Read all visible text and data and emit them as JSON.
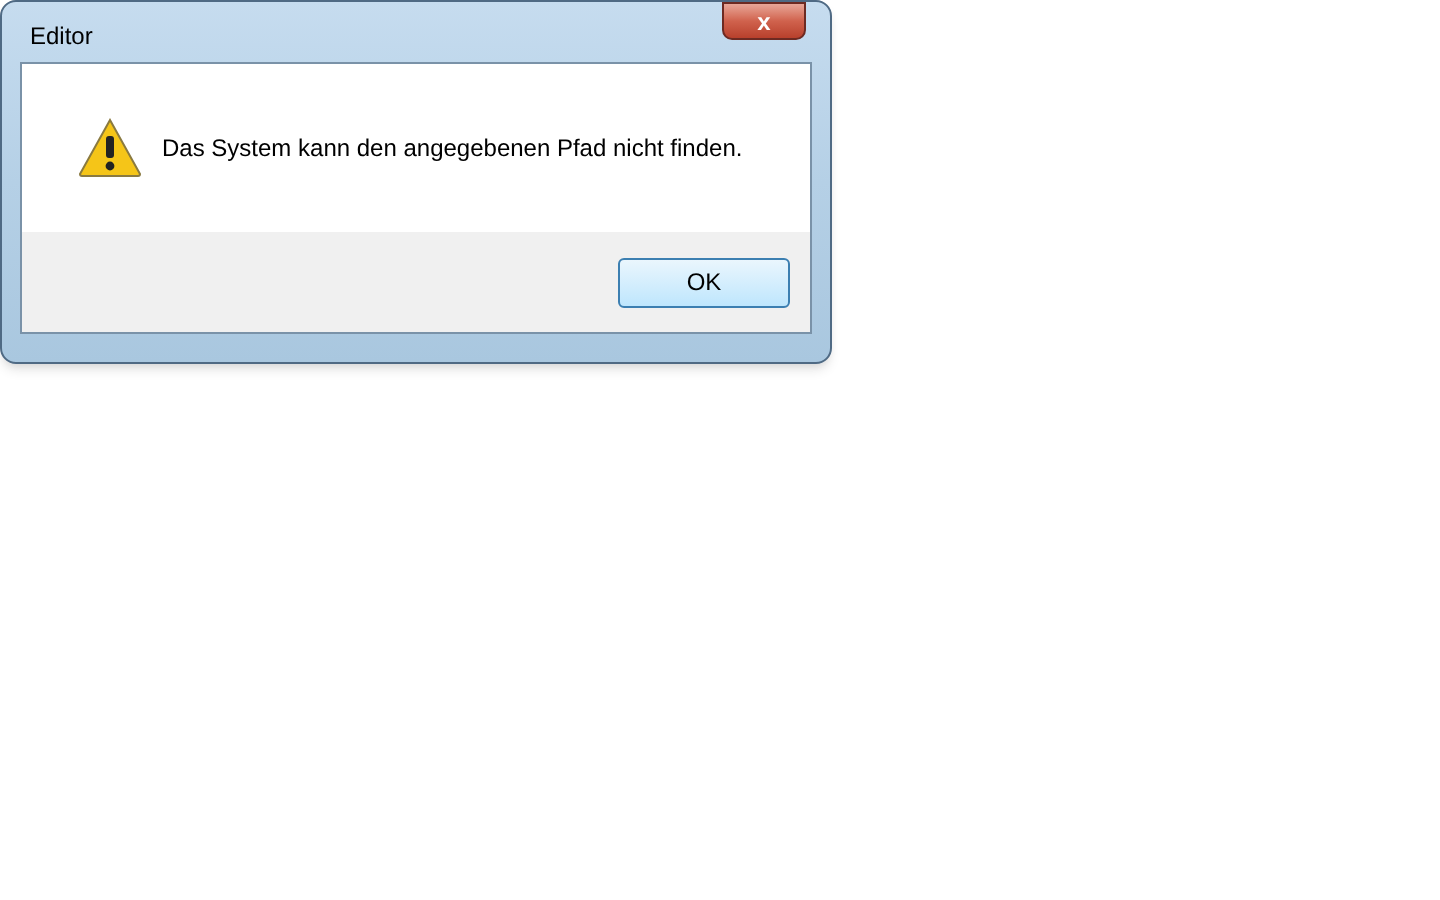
{
  "window": {
    "title": "Editor",
    "close": "x"
  },
  "message": {
    "kind": "warning",
    "text": "Das System kann den angegebenen Pfad nicht finden."
  },
  "buttons": [
    {
      "label": "OK",
      "selected": true
    }
  ]
}
